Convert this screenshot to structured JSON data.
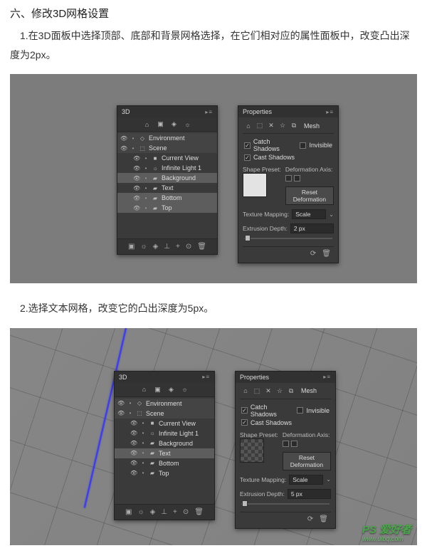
{
  "section": {
    "heading": "六、修改3D网格设置",
    "step1_text": "　1.在3D面板中选择顶部、底部和背景网格选择，在它们相对应的属性面板中，改变凸出深度为2px。",
    "step2_text": "　2.选择文本网格，改变它的凸出深度为5px。"
  },
  "panel3d": {
    "title": "3D",
    "tabs": [
      "⌂",
      "▣",
      "◈",
      "☼"
    ],
    "items": [
      {
        "label": "Environment",
        "kind": "top",
        "icon": "◇"
      },
      {
        "label": "Scene",
        "kind": "top",
        "icon": "⬚"
      },
      {
        "label": "Current View",
        "kind": "child",
        "icon": "■"
      },
      {
        "label": "Infinite Light 1",
        "kind": "child",
        "icon": "☼"
      },
      {
        "label": "Background",
        "kind": "child",
        "icon": "▰"
      },
      {
        "label": "Text",
        "kind": "child",
        "icon": "▰"
      },
      {
        "label": "Bottom",
        "kind": "child",
        "icon": "▰"
      },
      {
        "label": "Top",
        "kind": "child",
        "icon": "▰"
      }
    ],
    "screenshot1_highlights": [
      "Background",
      "Bottom",
      "Top"
    ],
    "screenshot2_highlights": [
      "Text"
    ],
    "footer_icons": [
      "▣",
      "☼",
      "◈",
      "⊥",
      "+",
      "⊙",
      "🗑"
    ]
  },
  "properties": {
    "title": "Properties",
    "icon_row": [
      "⌂",
      "⬚",
      "✕",
      "☆",
      "⧉"
    ],
    "mesh_label": "Mesh",
    "catch_shadows": "Catch Shadows",
    "invisible": "Invisible",
    "cast_shadows": "Cast Shadows",
    "shape_preset": "Shape Preset:",
    "deformation_axis": "Deformation Axis:",
    "reset_deformation": "Reset Deformation",
    "texture_mapping": "Texture Mapping:",
    "texture_value": "Scale",
    "extrusion_depth": "Extrusion Depth:",
    "extrusion_value_1": "2 px",
    "extrusion_value_2": "5 px",
    "footer_icons": [
      "⟳",
      "🗑"
    ]
  },
  "watermark": {
    "main": "PS 爱好者",
    "sub": "www.uibq.com"
  }
}
